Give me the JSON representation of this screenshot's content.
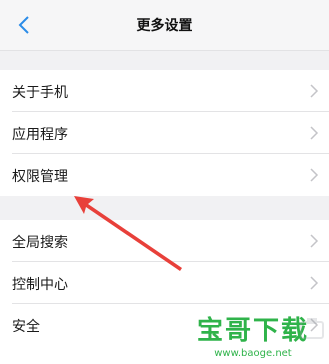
{
  "header": {
    "title": "更多设置",
    "back_icon": "chevron-left-icon"
  },
  "group1": {
    "items": [
      {
        "label": "关于手机"
      },
      {
        "label": "应用程序"
      },
      {
        "label": "权限管理"
      }
    ]
  },
  "group2": {
    "items": [
      {
        "label": "全局搜索"
      },
      {
        "label": "控制中心"
      },
      {
        "label": "安全"
      }
    ]
  },
  "annotation": {
    "arrow_color": "#e8403a",
    "points_to": "权限管理"
  },
  "watermark": {
    "text": "宝哥下载",
    "url": "www.baoge.net",
    "color": "#2fb34a"
  },
  "colors": {
    "accent": "#2b8ce8",
    "background": "#f1f1f3",
    "chevron": "#c4c4c8"
  }
}
